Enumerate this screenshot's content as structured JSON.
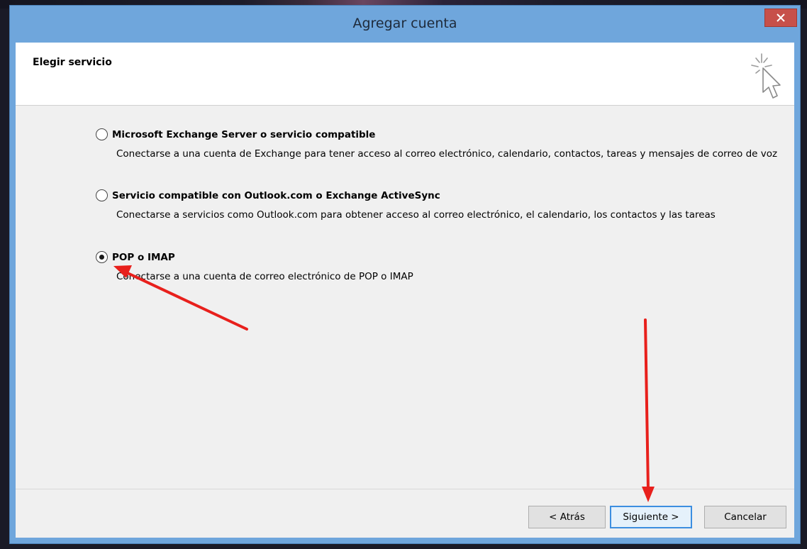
{
  "window": {
    "title": "Agregar cuenta",
    "close_glyph": "×"
  },
  "header": {
    "title": "Elegir servicio",
    "icon": "wizard-cursor-sparkle-icon"
  },
  "options": [
    {
      "label": "Microsoft Exchange Server o servicio compatible",
      "description": "Conectarse a una cuenta de Exchange para tener acceso al correo electrónico, calendario, contactos, tareas y mensajes de correo de voz",
      "selected": false
    },
    {
      "label": "Servicio compatible con Outlook.com o Exchange ActiveSync",
      "description": "Conectarse a servicios como Outlook.com para obtener acceso al correo electrónico, el calendario, los contactos y las tareas",
      "selected": false
    },
    {
      "label": "POP o IMAP",
      "description": "Conectarse a una cuenta de correo electrónico de POP o IMAP",
      "selected": true
    }
  ],
  "footer": {
    "back_label": "< Atrás",
    "next_label": "Siguiente >",
    "cancel_label": "Cancelar"
  },
  "annotations": {
    "arrow_color": "#e8201c",
    "arrows": [
      "arrow-to-pop-imap-option",
      "arrow-to-next-button"
    ]
  },
  "colors": {
    "titlebar": "#6fa6dc",
    "close_button": "#c7504a",
    "dialog_bg": "#f0f0f0"
  }
}
